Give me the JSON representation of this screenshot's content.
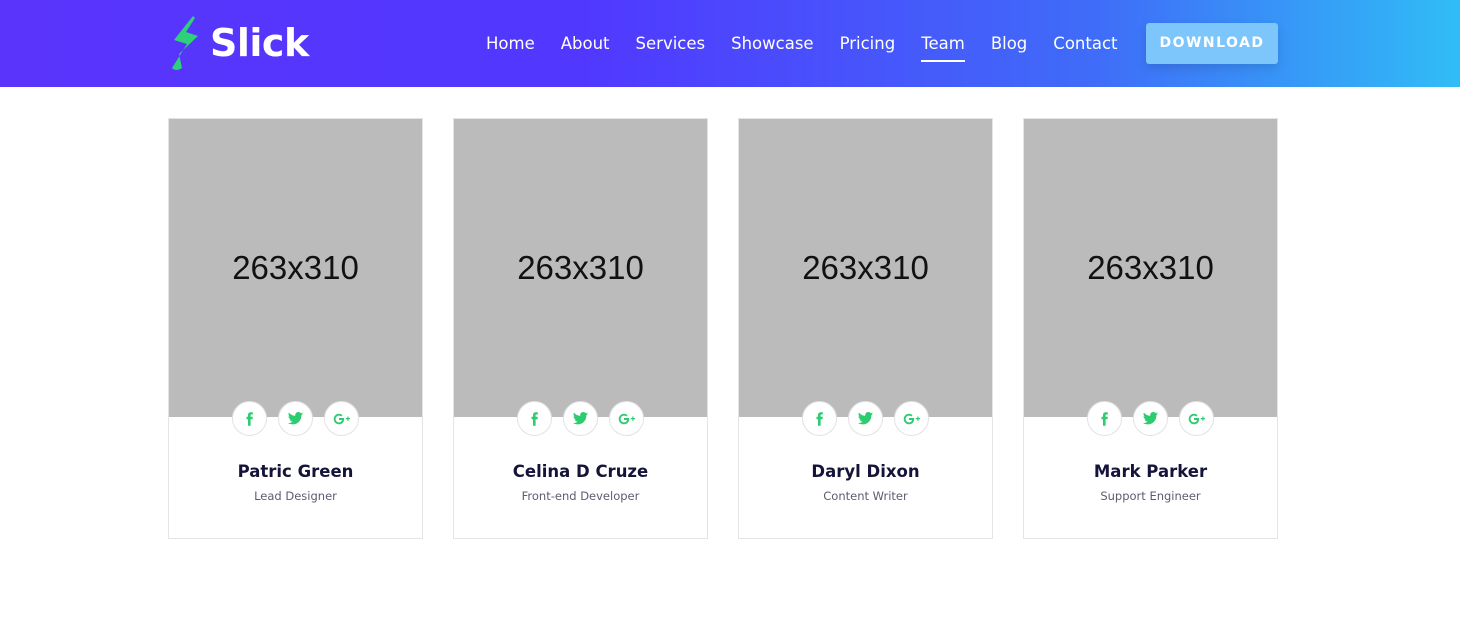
{
  "brand": {
    "name": "Slick",
    "logo_icon": "lightning-bolt-icon",
    "logo_color": "#2fd07a"
  },
  "nav": {
    "items": [
      {
        "label": "Home",
        "active": false
      },
      {
        "label": "About",
        "active": false
      },
      {
        "label": "Services",
        "active": false
      },
      {
        "label": "Showcase",
        "active": false
      },
      {
        "label": "Pricing",
        "active": false
      },
      {
        "label": "Team",
        "active": true
      },
      {
        "label": "Blog",
        "active": false
      },
      {
        "label": "Contact",
        "active": false
      }
    ],
    "download_label": "DOWNLOAD"
  },
  "colors": {
    "gradient_start": "#5a34fb",
    "gradient_end": "#30bdf6",
    "social_icon": "#2ecc71",
    "button": "#7cc6fb"
  },
  "team": [
    {
      "photo_placeholder": "263x310",
      "name": "Patric Green",
      "role": "Lead Designer"
    },
    {
      "photo_placeholder": "263x310",
      "name": "Celina D Cruze",
      "role": "Front-end Developer"
    },
    {
      "photo_placeholder": "263x310",
      "name": "Daryl Dixon",
      "role": "Content Writer"
    },
    {
      "photo_placeholder": "263x310",
      "name": "Mark Parker",
      "role": "Support Engineer"
    }
  ],
  "social_icons": [
    "facebook-icon",
    "twitter-icon",
    "google-plus-icon"
  ]
}
